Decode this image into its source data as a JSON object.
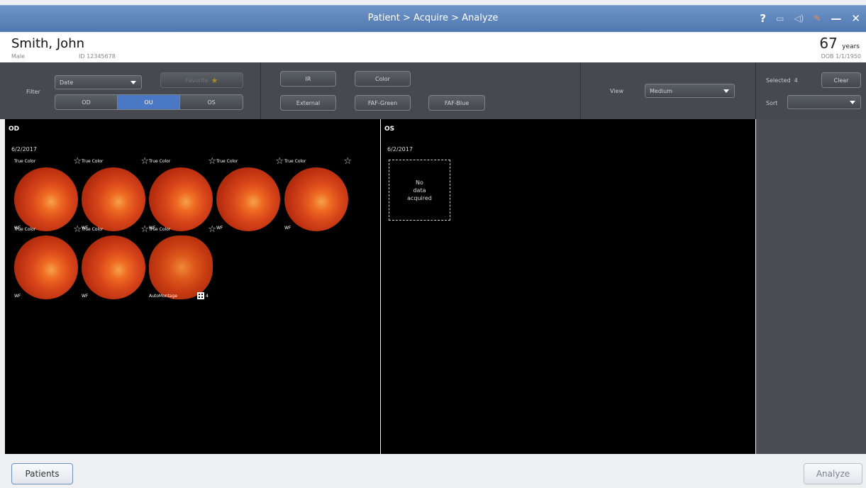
{
  "window": {
    "title": "Patient > Acquire > Analyze",
    "controls": {
      "help": "?",
      "minimize": "—",
      "close": "✕"
    }
  },
  "patient": {
    "name": "Smith, John",
    "sex": "Male",
    "id": "ID 12345678",
    "age": "67",
    "age_unit": "years",
    "dob": "DOB  1/1/1950"
  },
  "toolbar": {
    "filter_label": "Filter",
    "filter_select": "Date",
    "favorite_label": "Favorite",
    "eye_segments": [
      "OD",
      "OU",
      "OS"
    ],
    "eye_active": "OU",
    "modality_buttons": [
      "IR",
      "Color",
      "External",
      "FAF-Green",
      "FAF-Blue"
    ],
    "view_label": "View",
    "view_select": "Medium",
    "selected_label": "Selected",
    "selected_count": "4",
    "clear_label": "Clear",
    "sort_label": "Sort",
    "sort_select": ""
  },
  "od": {
    "title": "OD",
    "date": "6/2/2017",
    "images": [
      {
        "caption": "True Color",
        "sub": "WF"
      },
      {
        "caption": "True Color",
        "sub": "WF"
      },
      {
        "caption": "True Color",
        "sub": "WF"
      },
      {
        "caption": "True Color",
        "sub": "WF"
      },
      {
        "caption": "True Color",
        "sub": "WF"
      },
      {
        "caption": "True Color",
        "sub": "WF"
      },
      {
        "caption": "True Color",
        "sub": "WF"
      },
      {
        "caption": "True Color",
        "sub": "AutoMontage",
        "montage_count": "4"
      }
    ]
  },
  "os": {
    "title": "OS",
    "date": "6/2/2017",
    "no_data": "No\ndata\nacquired"
  },
  "footer": {
    "patients_button": "Patients",
    "analyze_button": "Analyze"
  },
  "colors": {
    "titlebar": "#5a82b8",
    "active": "#4a78c4",
    "toolbar_bg": "#464a50",
    "fundus": "#d8451a"
  }
}
